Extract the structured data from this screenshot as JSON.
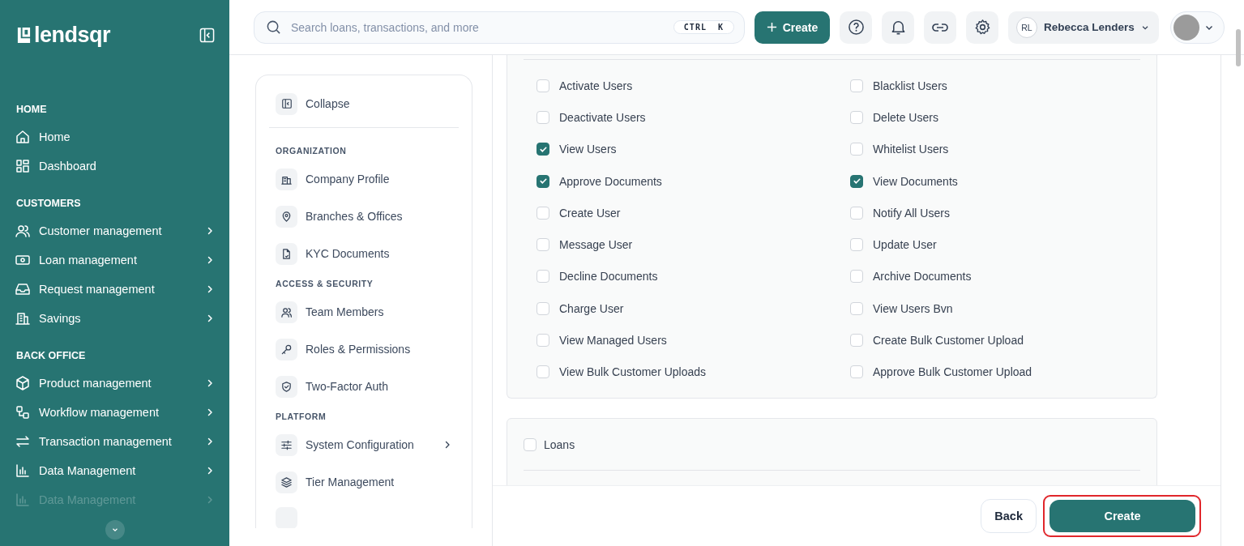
{
  "brand": {
    "name": "lendsqr"
  },
  "sidebar": {
    "sections": [
      {
        "title": "HOME",
        "items": [
          {
            "label": "Home",
            "has_submenu": false,
            "faded": false
          },
          {
            "label": "Dashboard",
            "has_submenu": false,
            "faded": false
          }
        ]
      },
      {
        "title": "CUSTOMERS",
        "items": [
          {
            "label": "Customer management",
            "has_submenu": true,
            "faded": false
          },
          {
            "label": "Loan management",
            "has_submenu": true,
            "faded": false
          },
          {
            "label": "Request management",
            "has_submenu": true,
            "faded": false
          },
          {
            "label": "Savings",
            "has_submenu": true,
            "faded": false
          }
        ]
      },
      {
        "title": "BACK OFFICE",
        "items": [
          {
            "label": "Product management",
            "has_submenu": true,
            "faded": false
          },
          {
            "label": "Workflow management",
            "has_submenu": true,
            "faded": false
          },
          {
            "label": "Transaction management",
            "has_submenu": true,
            "faded": false
          },
          {
            "label": "Data Management",
            "has_submenu": true,
            "faded": false
          },
          {
            "label": "Data Management",
            "has_submenu": true,
            "faded": true
          }
        ]
      }
    ]
  },
  "topbar": {
    "search": {
      "placeholder": "Search loans, transactions, and more",
      "shortcut": "CTRL  K"
    },
    "create_button": "Create",
    "user": {
      "initials": "RL",
      "name": "Rebecca Lenders"
    }
  },
  "settings_nav": {
    "collapse": "Collapse",
    "sections": [
      {
        "title": "ORGANIZATION",
        "items": [
          {
            "label": "Company Profile",
            "has_submenu": false
          },
          {
            "label": "Branches & Offices",
            "has_submenu": false
          },
          {
            "label": "KYC Documents",
            "has_submenu": false
          }
        ]
      },
      {
        "title": "ACCESS & SECURITY",
        "items": [
          {
            "label": "Team Members",
            "has_submenu": false
          },
          {
            "label": "Roles & Permissions",
            "has_submenu": false
          },
          {
            "label": "Two-Factor Auth",
            "has_submenu": false
          }
        ]
      },
      {
        "title": "PLATFORM",
        "items": [
          {
            "label": "System Configuration",
            "has_submenu": true
          },
          {
            "label": "Tier Management",
            "has_submenu": false
          }
        ]
      }
    ]
  },
  "permissions": [
    {
      "label": "Activate Users",
      "checked": false
    },
    {
      "label": "Blacklist Users",
      "checked": false
    },
    {
      "label": "Deactivate Users",
      "checked": false
    },
    {
      "label": "Delete Users",
      "checked": false
    },
    {
      "label": "View Users",
      "checked": true
    },
    {
      "label": "Whitelist Users",
      "checked": false
    },
    {
      "label": "Approve Documents",
      "checked": true
    },
    {
      "label": "View Documents",
      "checked": true
    },
    {
      "label": "Create User",
      "checked": false
    },
    {
      "label": "Notify All Users",
      "checked": false
    },
    {
      "label": "Message User",
      "checked": false
    },
    {
      "label": "Update User",
      "checked": false
    },
    {
      "label": "Decline Documents",
      "checked": false
    },
    {
      "label": "Archive Documents",
      "checked": false
    },
    {
      "label": "Charge User",
      "checked": false
    },
    {
      "label": "View Users Bvn",
      "checked": false
    },
    {
      "label": "View Managed Users",
      "checked": false
    },
    {
      "label": "Create Bulk Customer Upload",
      "checked": false
    },
    {
      "label": "View Bulk Customer Uploads",
      "checked": false
    },
    {
      "label": "Approve Bulk Customer Upload",
      "checked": false
    }
  ],
  "groups": [
    {
      "label": "Loans",
      "checked": false
    }
  ],
  "footer": {
    "back": "Back",
    "create": "Create",
    "create_highlighted": true
  }
}
